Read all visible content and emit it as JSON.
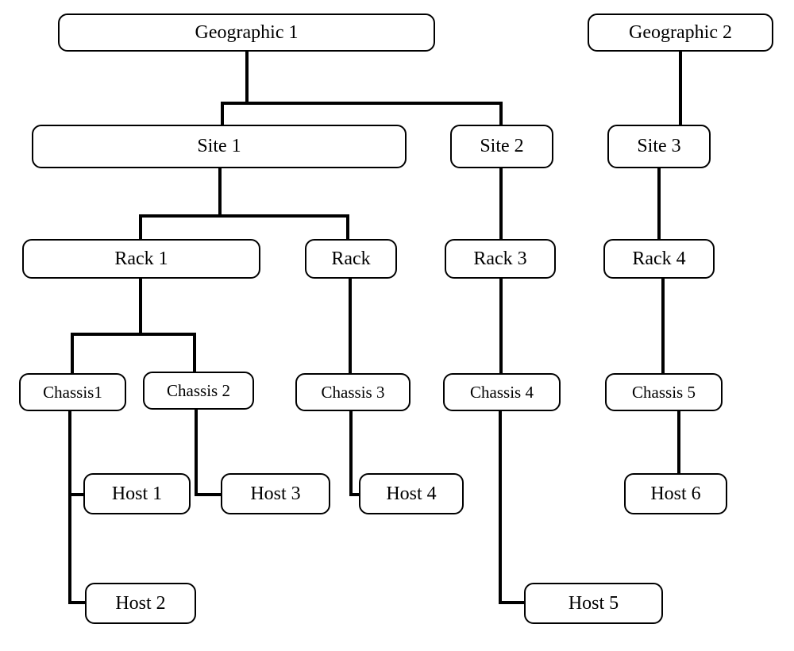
{
  "nodes": {
    "geographic1": "Geographic 1",
    "geographic2": "Geographic 2",
    "site1": "Site 1",
    "site2": "Site 2",
    "site3": "Site 3",
    "rack1": "Rack 1",
    "rack2": "Rack",
    "rack3": "Rack 3",
    "rack4": "Rack 4",
    "chassis1": "Chassis1",
    "chassis2": "Chassis 2",
    "chassis3": "Chassis 3",
    "chassis4": "Chassis 4",
    "chassis5": "Chassis 5",
    "host1": "Host 1",
    "host2": "Host 2",
    "host3": "Host 3",
    "host4": "Host 4",
    "host5": "Host 5",
    "host6": "Host 6"
  }
}
